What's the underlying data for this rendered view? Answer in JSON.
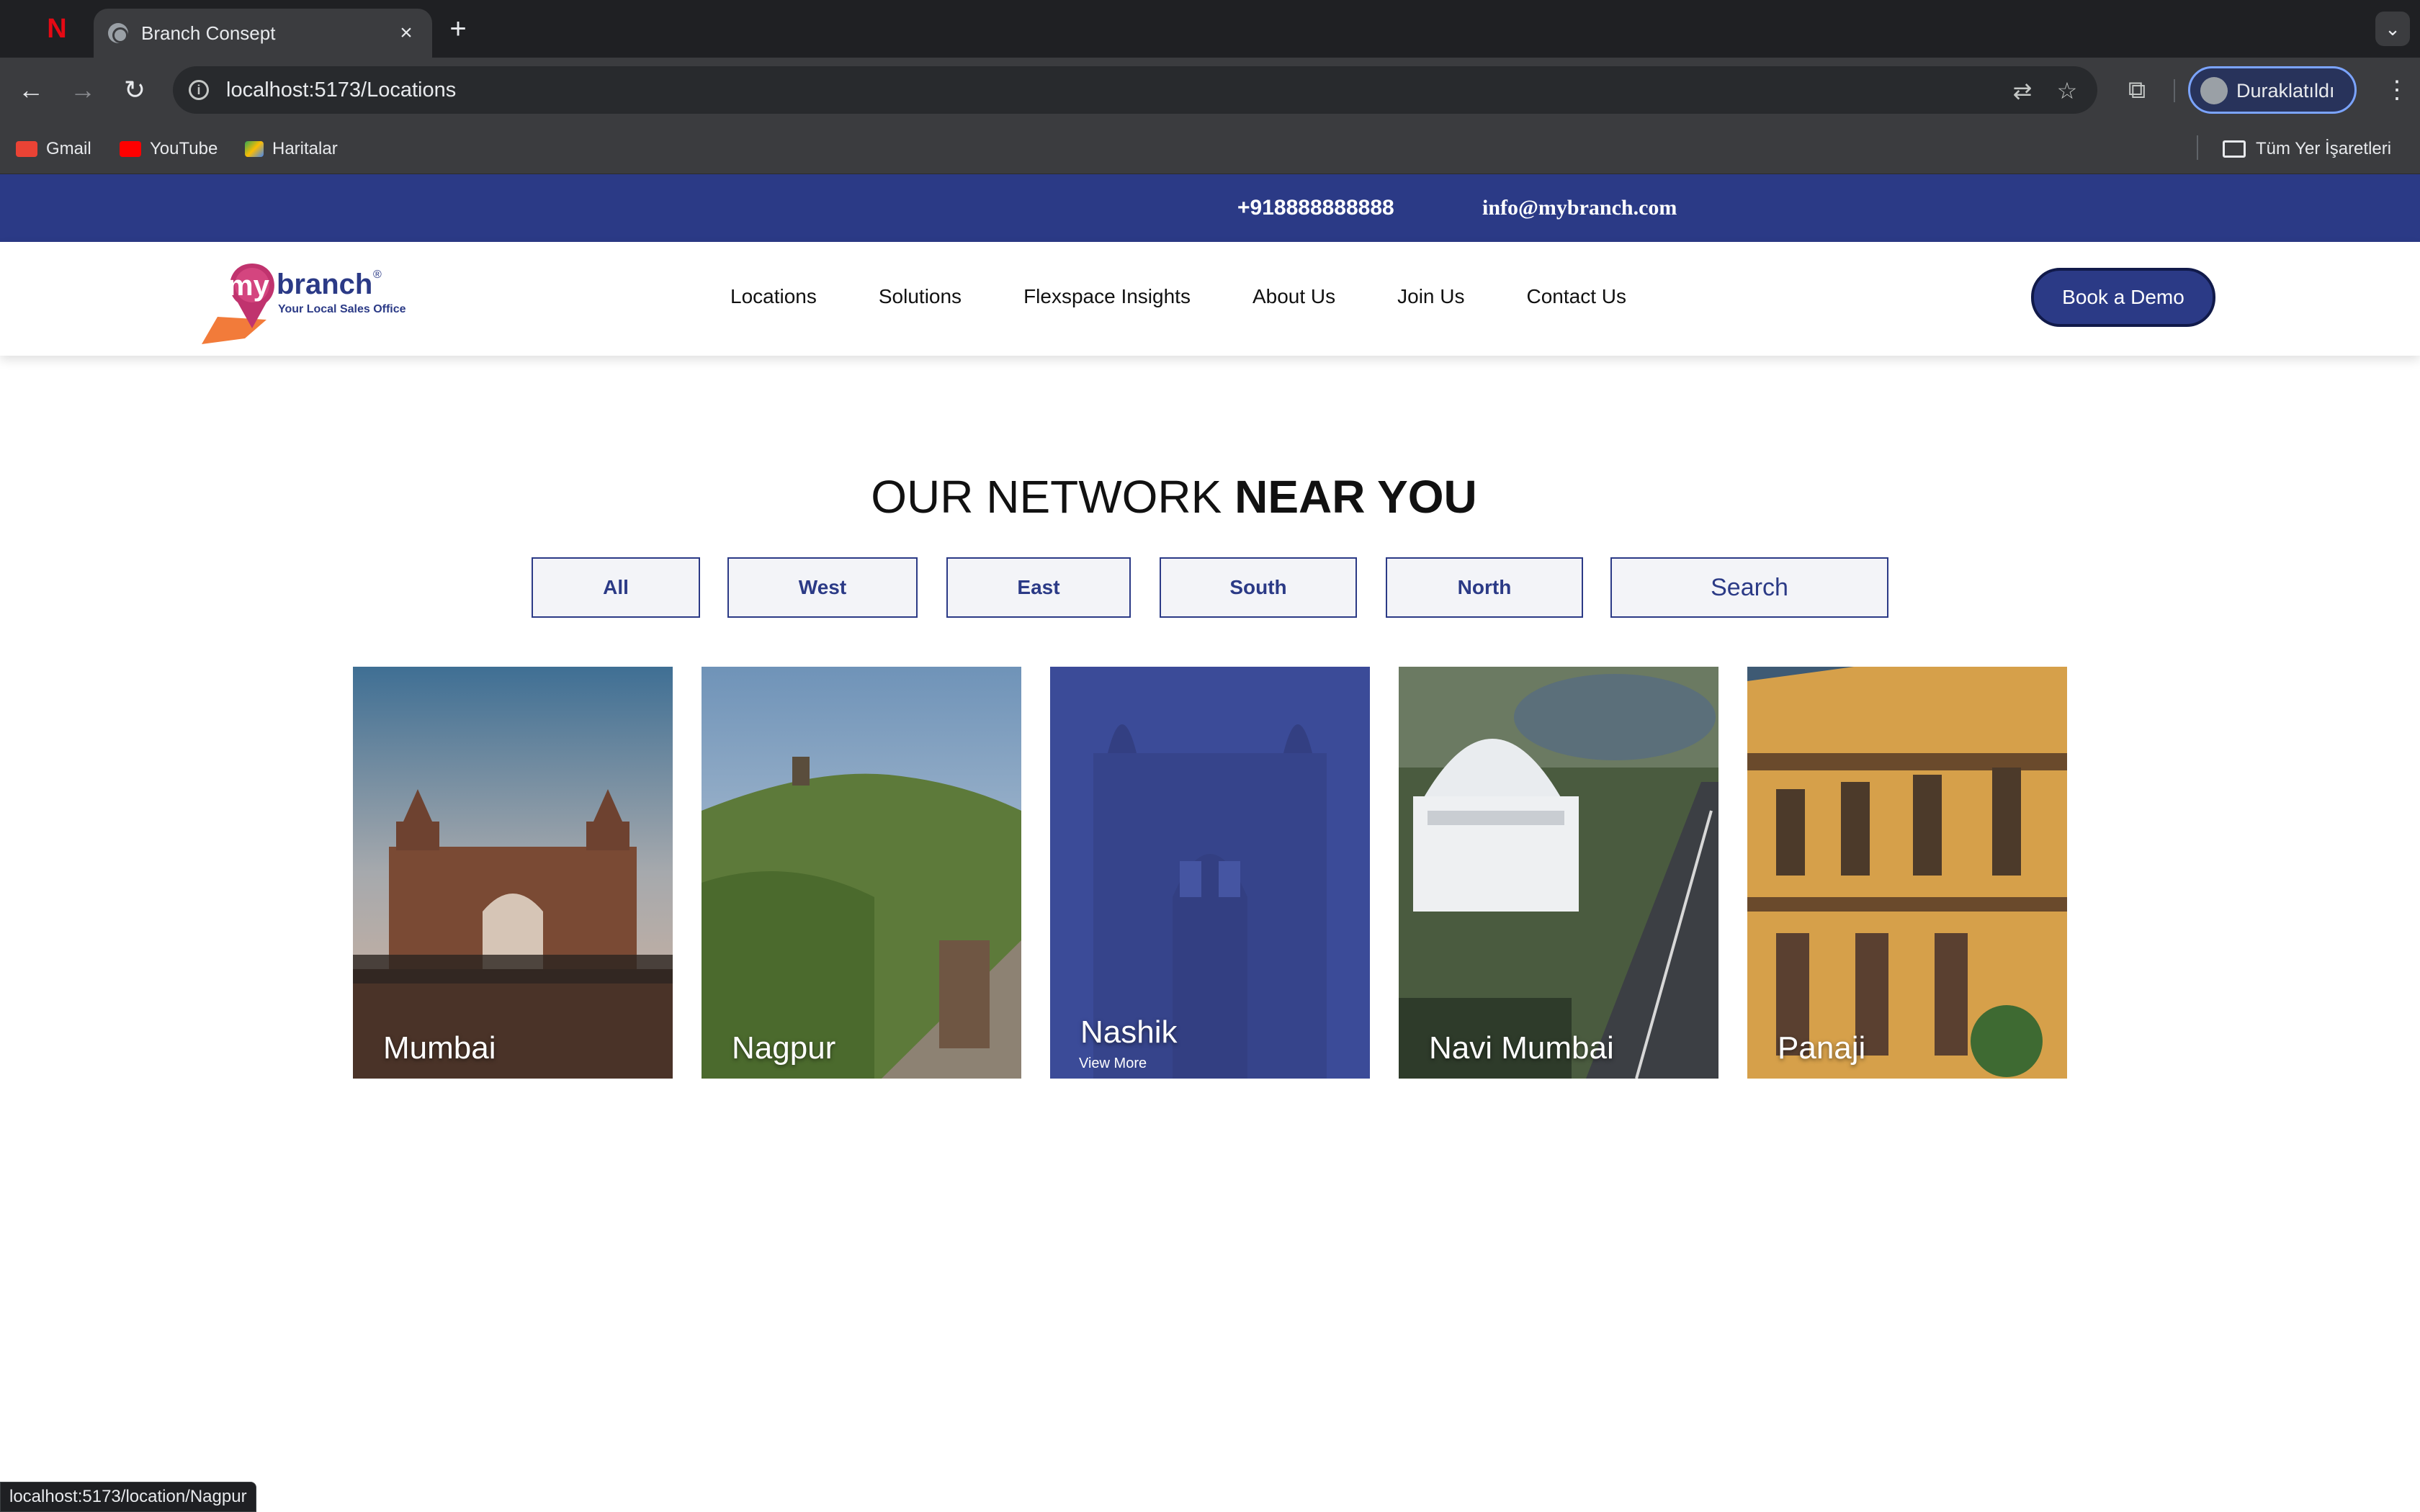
{
  "browser": {
    "tab_title": "Branch Consept",
    "url": "localhost:5173/Locations",
    "profile_label": "Duraklatıldı",
    "bookmarks": [
      {
        "label": "Gmail",
        "icon": "gmail-icon",
        "color": "#ea4335"
      },
      {
        "label": "YouTube",
        "icon": "youtube-icon",
        "color": "#ff0000"
      },
      {
        "label": "Haritalar",
        "icon": "maps-icon",
        "color": "#34a853"
      }
    ],
    "all_bookmarks_label": "Tüm Yer İşaretleri",
    "status_url": "localhost:5173/location/Nagpur"
  },
  "site": {
    "phone": "+918888888888",
    "email": "info@mybranch.com",
    "logo": {
      "primary": "my",
      "secondary": "branch",
      "tagline": "Your Local Sales Office",
      "registered": "®"
    },
    "nav": [
      "Locations",
      "Solutions",
      "Flexspace Insights",
      "About Us",
      "Join Us",
      "Contact Us"
    ],
    "cta": "Book a Demo",
    "heading_light": "OUR NETWORK",
    "heading_bold": "NEAR YOU",
    "filters": [
      "All",
      "West",
      "East",
      "South",
      "North",
      "Search"
    ],
    "cards": [
      {
        "city": "Mumbai",
        "sub": ""
      },
      {
        "city": "Nagpur",
        "sub": ""
      },
      {
        "city": "Nashik",
        "sub": "View More"
      },
      {
        "city": "Navi Mumbai",
        "sub": ""
      },
      {
        "city": "Panaji",
        "sub": ""
      }
    ],
    "colors": {
      "brand_blue": "#2b3a86",
      "logo_pink": "#c0336e",
      "logo_orange": "#f27b3a"
    }
  }
}
